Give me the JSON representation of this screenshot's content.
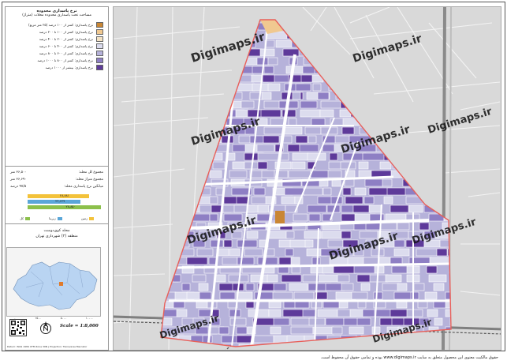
{
  "legend": {
    "title": "نرخ یاسداری محدوده",
    "subtitle": "مساحت تحت یاسداری محدوده محلات (متراژ)",
    "classes": [
      {
        "label": "نرخ پاسداری: کمتر از ۱۰۰ درصد (۲۵ متر مربع)",
        "color": "#c98634"
      },
      {
        "label": "نرخ پاسداری: کمتر از ۱۰۰ تا ۲۰۰ درصد",
        "color": "#f0c890"
      },
      {
        "label": "نرخ پاسداری: کمتر از ۲۰۰ تا ۴۰۰ درصد",
        "color": "#f3e2c4"
      },
      {
        "label": "نرخ پاسداری: کمتر از ۴۰۰ تا ۶۰۰ درصد",
        "color": "#dcdcee"
      },
      {
        "label": "نرخ پاسداری: کمتر از ۶۰۰ تا ۸۰۰ درصد",
        "color": "#b6b2da"
      },
      {
        "label": "نرخ پاسداری: کمتر از ۸۰۰ تا ۱۰۰۰ درصد",
        "color": "#8e7fc4"
      },
      {
        "label": "نرخ پاسداری: بیشتر از ۱۰۰۰ درصد",
        "color": "#5e3a9a"
      }
    ]
  },
  "stats": [
    {
      "label": "مجموع کل محله:",
      "value": "۳۶,۵۰۰ متر"
    },
    {
      "label": "مجموع متراژ محله:",
      "value": "۳۶,۶۹۰ متر"
    },
    {
      "label": "میانگین نرخ پاسداری محله:",
      "value": "۹۷/۵ درصد"
    }
  ],
  "bars": {
    "series": [
      {
        "name": "زمین",
        "value": "۲۸,۸۸۱",
        "color": "#f3c23a",
        "fraction": 0.82
      },
      {
        "name": "زیربنا",
        "value": "۲۲,۶۶۹",
        "color": "#5aa6d8",
        "fraction": 0.7
      },
      {
        "name": "کل",
        "value": "۲۸,۸۵۰",
        "color": "#8cc04b",
        "fraction": 0.98
      }
    ]
  },
  "location": {
    "title": "محله کوی‌دوست",
    "subtitle": "منطقه (۲) شهرداری تهران"
  },
  "inset_scale": [
    "۰",
    "۲۵۰۰",
    "۵۰۰۰",
    "۱۰۰۰۰"
  ],
  "scale_text": "Scale = 1:8,000",
  "legend_footer": "Datum: WGS 1984 UTM Zone 39N | Projection: Transverse Mercator",
  "watermark": "Digimaps.ir",
  "footer_text": "حقوق مالکیت معنوی این محصول متعلق به سایت www.digimaps.ir بوده و تمامی حقوق آن محفوظ است.",
  "colors": {
    "boundary": "#e8605a",
    "road": "#ffffff",
    "basemap": "#d9d9d9",
    "railway": "#555555"
  }
}
